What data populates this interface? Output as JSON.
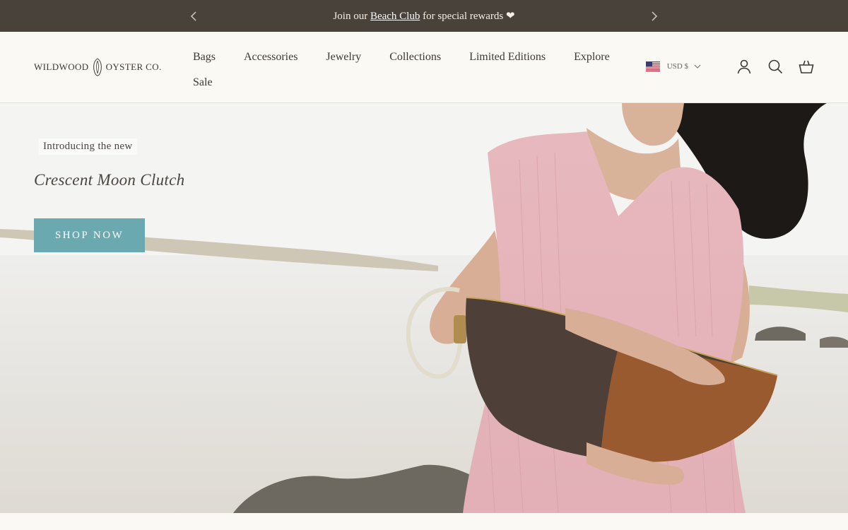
{
  "announcement": {
    "prefix": "Join our ",
    "link": "Beach Club",
    "suffix": " for special rewards ❤"
  },
  "brand": {
    "name_left": "WILDWOOD",
    "name_right": "OYSTER CO."
  },
  "nav": {
    "items": [
      "Bags",
      "Accessories",
      "Jewelry",
      "Collections",
      "Limited Editions",
      "Explore"
    ],
    "second_row": [
      "Sale"
    ]
  },
  "utility": {
    "currency": "USD $"
  },
  "hero": {
    "eyebrow": "Introducing the new",
    "headline": "Crescent Moon Clutch",
    "cta": "SHOP NOW"
  },
  "colors": {
    "announcement_bg": "#48423b",
    "header_bg": "#fbf9f3",
    "cta_bg": "#6aa9b0",
    "text": "#3d3834"
  }
}
